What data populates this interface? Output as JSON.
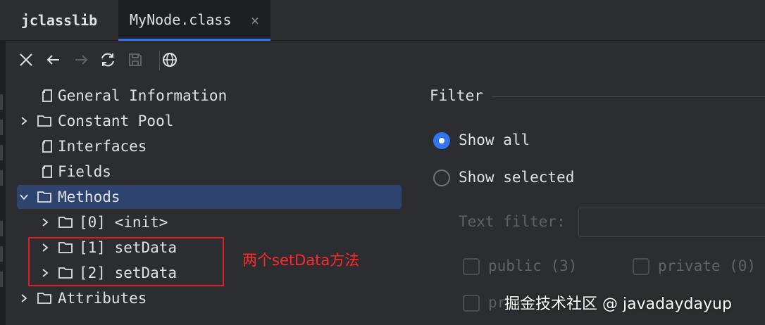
{
  "tabs": {
    "jclasslib_label": "jclasslib",
    "file_label": "MyNode.class",
    "close_glyph": "×"
  },
  "toolbar": {
    "icons": [
      "close-icon",
      "back-arrow-icon",
      "forward-arrow-icon",
      "refresh-icon",
      "save-icon",
      "browser-globe-icon"
    ]
  },
  "tree": {
    "items": [
      {
        "label": "General Information"
      },
      {
        "label": "Constant Pool"
      },
      {
        "label": "Interfaces"
      },
      {
        "label": "Fields"
      },
      {
        "label": "Methods"
      },
      {
        "label": "[0] <init>"
      },
      {
        "label": "[1] setData"
      },
      {
        "label": "[2] setData"
      },
      {
        "label": "Attributes"
      }
    ]
  },
  "annotation": {
    "text": "两个setData方法",
    "color": "#ff2a2a"
  },
  "filter": {
    "title": "Filter",
    "show_all": "Show all",
    "show_selected": "Show selected",
    "text_filter_label": "Text filter:",
    "text_filter_value": "",
    "public_label": "public (3)",
    "private_label": "private (0)",
    "third_label_partial": "pr"
  },
  "watermark": "掘金技术社区 @ javadaydayup",
  "colors": {
    "accent": "#3574f0",
    "selection": "#2e436e",
    "background": "#2b2d30"
  }
}
